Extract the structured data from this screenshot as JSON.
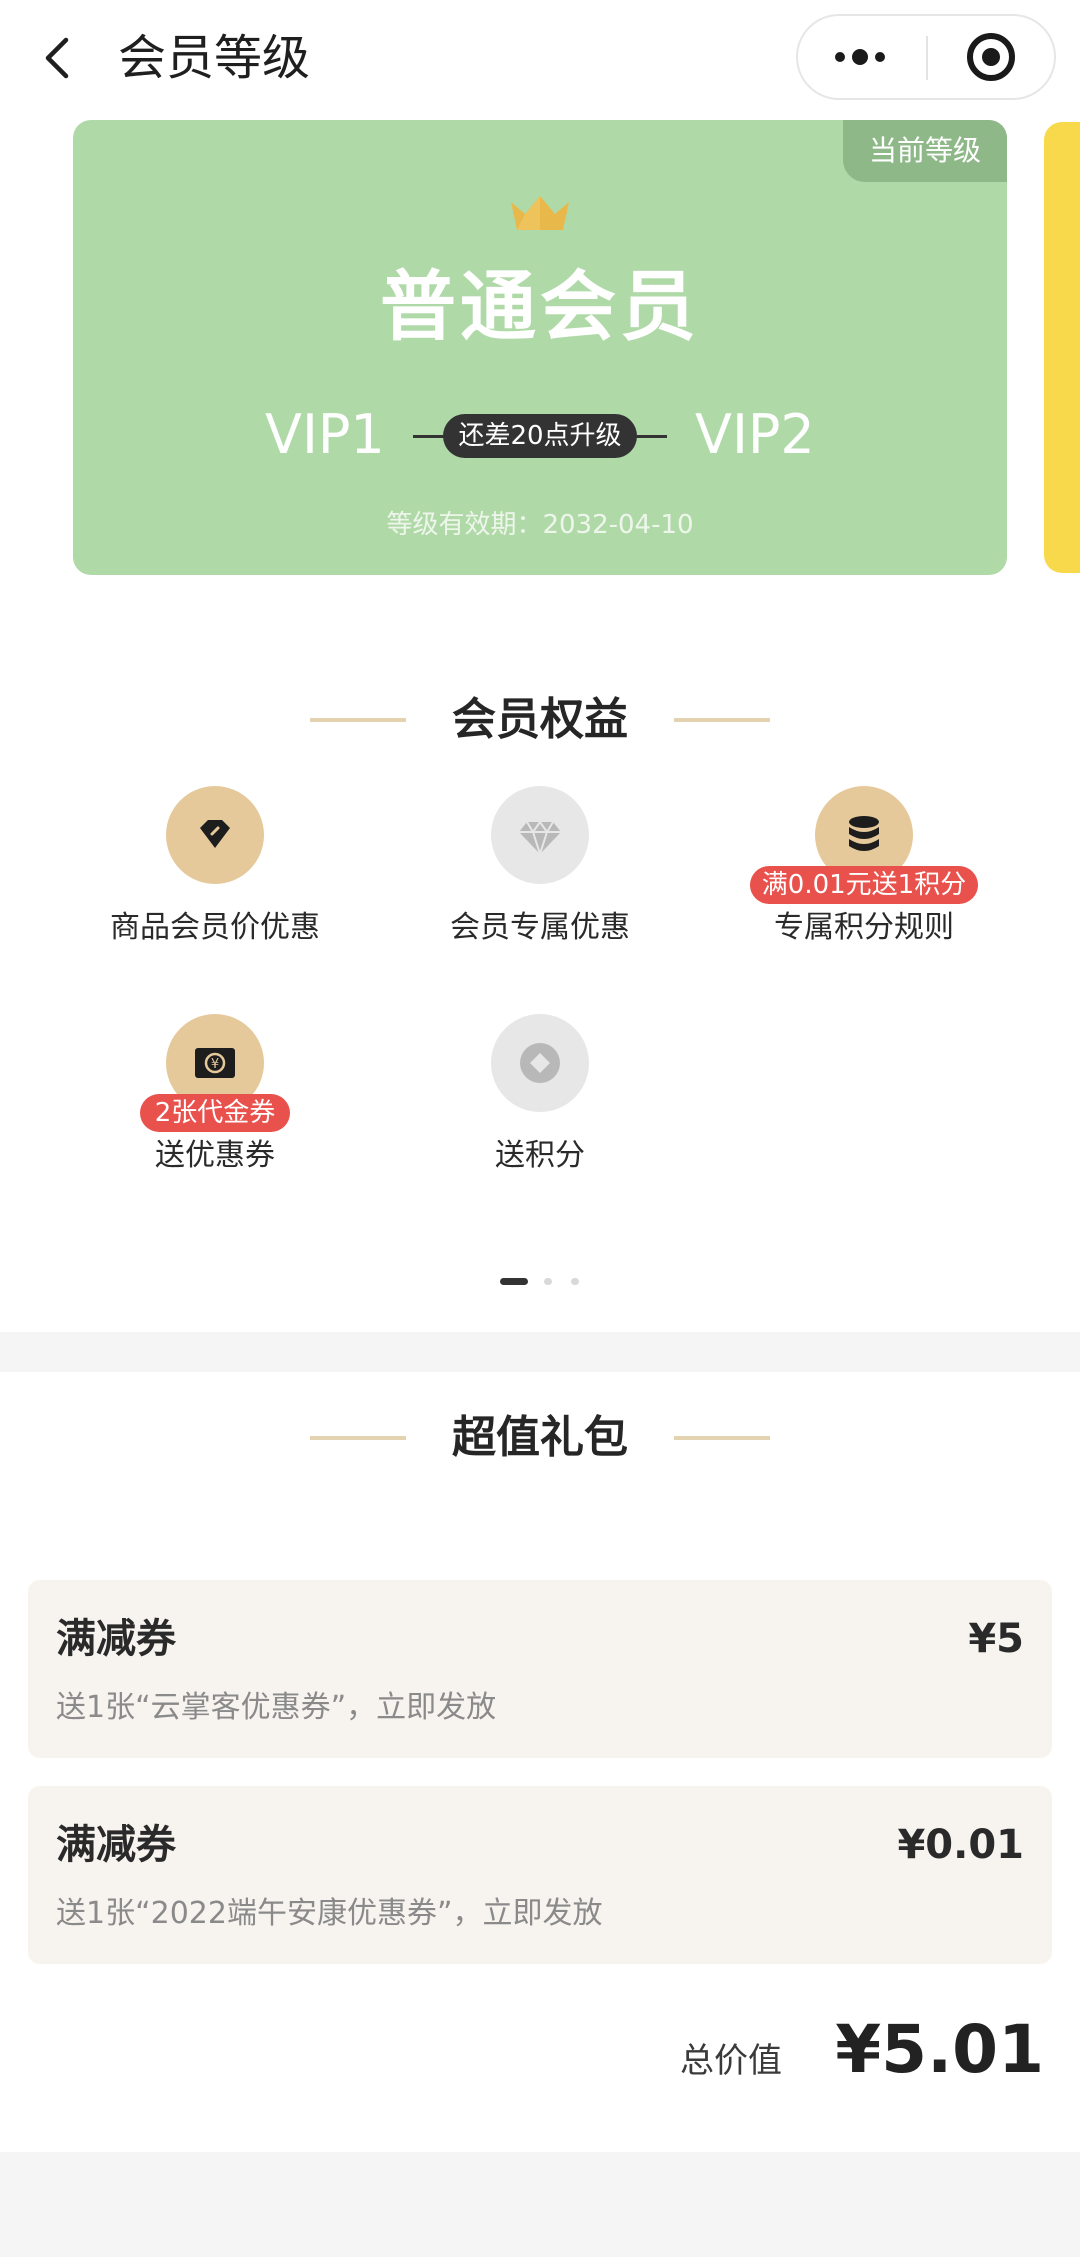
{
  "header": {
    "title": "会员等级"
  },
  "card": {
    "tag": "当前等级",
    "level_name": "普通会员",
    "current_vip": "VIP1",
    "next_vip": "VIP2",
    "progress_text": "还差20点升级",
    "validity": "等级有效期：2032-04-10",
    "color": "#b0d9a8"
  },
  "benefits": {
    "title": "会员权益",
    "items": [
      {
        "label": "商品会员价优惠",
        "icon": "tag-icon"
      },
      {
        "label": "会员专属优惠",
        "icon": "diamond-icon"
      },
      {
        "label": "专属积分规则",
        "icon": "coins-icon",
        "badge": "满0.01元送1积分"
      },
      {
        "label": "送优惠券",
        "icon": "voucher-icon",
        "badge": "2张代金券"
      },
      {
        "label": "送积分",
        "icon": "points-icon"
      }
    ],
    "page_count": 3,
    "active_page": 1
  },
  "gift": {
    "title": "超值礼包",
    "coupons": [
      {
        "name": "满减券",
        "price": "¥5",
        "desc": "送1张“云掌客优惠券”，立即发放"
      },
      {
        "name": "满减券",
        "price": "¥0.01",
        "desc": "送1张“2022端午安康优惠券”，立即发放"
      }
    ],
    "total_label": "总价值",
    "total_value": "¥5.01"
  }
}
